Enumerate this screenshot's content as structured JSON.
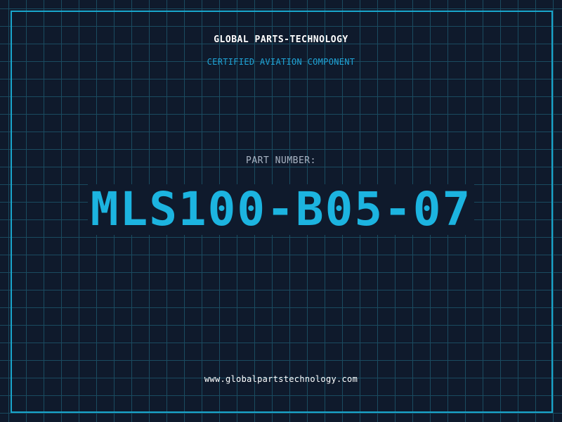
{
  "header": {
    "company_name": "GLOBAL PARTS-TECHNOLOGY",
    "tagline": "CERTIFIED AVIATION COMPONENT"
  },
  "part": {
    "label": "PART NUMBER:",
    "number": "MLS100-B05-07"
  },
  "footer": {
    "website": "www.globalpartstechnology.com"
  },
  "colors": {
    "background": "#0f1a2c",
    "grid": "#1a4b60",
    "accent": "#19a6cc",
    "part_number": "#1cb4e0",
    "label": "#aab5c4",
    "text": "#ffffff"
  }
}
